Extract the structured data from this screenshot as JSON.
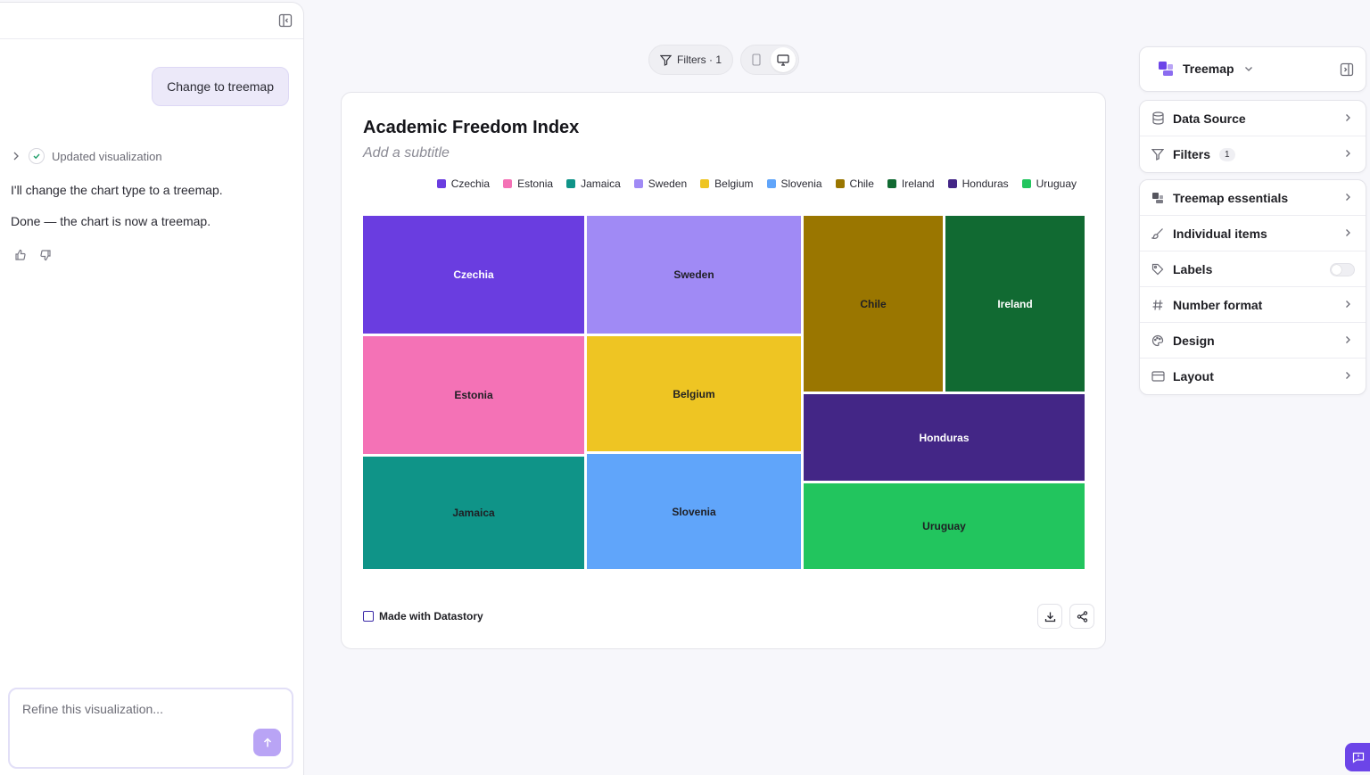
{
  "chat": {
    "user_message": "Change to treemap",
    "step_label": "Updated visualization",
    "ai_messages": [
      "I'll change the chart type to a treemap.",
      "Done — the chart is now a treemap."
    ],
    "composer_placeholder": "Refine this visualization..."
  },
  "toolbar": {
    "filters_label": "Filters · 1"
  },
  "chart": {
    "title": "Academic Freedom Index",
    "subtitle_placeholder": "Add a subtitle",
    "brand_label": "Made with Datastory"
  },
  "settings": {
    "chart_type": "Treemap",
    "sections": [
      {
        "label": "Data Source",
        "icon": "database-icon"
      },
      {
        "label": "Filters",
        "icon": "filter-icon",
        "badge": "1"
      }
    ],
    "options": [
      {
        "label": "Treemap essentials",
        "icon": "treemap-icon"
      },
      {
        "label": "Individual items",
        "icon": "brush-icon"
      },
      {
        "label": "Labels",
        "icon": "tag-icon",
        "toggle": false
      },
      {
        "label": "Number format",
        "icon": "hash-icon"
      },
      {
        "label": "Design",
        "icon": "palette-icon"
      },
      {
        "label": "Layout",
        "icon": "layout-icon"
      }
    ]
  },
  "colors": {
    "accent": "#6c45e8"
  },
  "chart_data": {
    "type": "treemap",
    "title": "Academic Freedom Index",
    "legend_position": "top-right",
    "items": [
      {
        "name": "Czechia",
        "color": "#6a3de0",
        "label_color": "#ffffff"
      },
      {
        "name": "Estonia",
        "color": "#f472b6",
        "label_color": "#1f1f24"
      },
      {
        "name": "Jamaica",
        "color": "#0f9488",
        "label_color": "#1f1f24"
      },
      {
        "name": "Sweden",
        "color": "#a08af5",
        "label_color": "#1f1f24"
      },
      {
        "name": "Belgium",
        "color": "#eec523",
        "label_color": "#1f1f24"
      },
      {
        "name": "Slovenia",
        "color": "#60a5fa",
        "label_color": "#1f1f24"
      },
      {
        "name": "Chile",
        "color": "#9a7600",
        "label_color": "#1f1f24"
      },
      {
        "name": "Ireland",
        "color": "#116a32",
        "label_color": "#ffffff"
      },
      {
        "name": "Honduras",
        "color": "#432686",
        "label_color": "#ffffff"
      },
      {
        "name": "Uruguay",
        "color": "#22c55e",
        "label_color": "#1f1f24"
      }
    ]
  }
}
